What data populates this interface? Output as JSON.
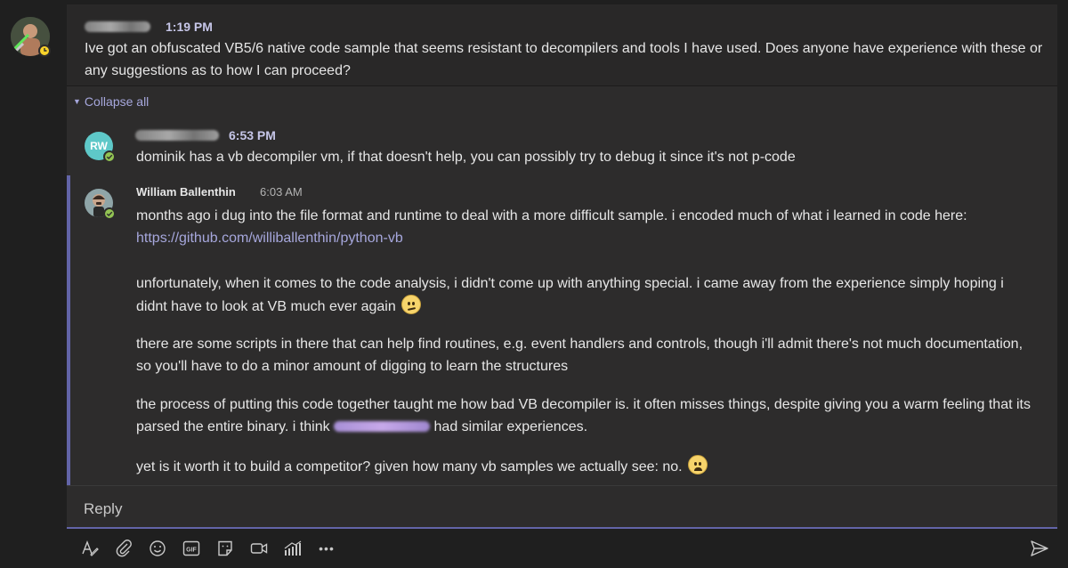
{
  "root": {
    "time": "1:19 PM",
    "text": "Ive got an obfuscated VB5/6 native code sample that seems resistant to decompilers and tools I have used. Does anyone have experience with these or any suggestions as to how I can proceed?",
    "presence": "away"
  },
  "collapse_label": "Collapse all",
  "replies": [
    {
      "initials": "RW",
      "avatar_color": "#5ec8c8",
      "time": "6:53 PM",
      "text": "dominik has a vb decompiler vm, if that doesn't help, you can possibly try to debug it since it's not p-code"
    },
    {
      "author": "William Ballenthin",
      "time": "6:03 AM",
      "p1": "months ago i dug into the file format and runtime to deal with a more difficult sample. i encoded much of what i learned in code here:",
      "link": "https://github.com/williballenthin/python-vb",
      "p2": "unfortunately, when it comes to the code analysis, i didn't come up with anything special. i came away from the experience simply hoping i didnt have to look at VB much ever again",
      "p3": "there are some scripts in there that can help find routines, e.g. event handlers and controls, though i'll admit there's not much documentation, so you'll have to do a minor amount of digging to learn the structures",
      "p4a": "the process of putting this code together taught me how bad VB decompiler is. it often misses things, despite giving you a warm feeling that its parsed the entire binary. i think",
      "p4b": "had similar experiences.",
      "p5": "yet is it worth it to build a competitor? given how many vb samples we actually see: no."
    }
  ],
  "reply_placeholder": "Reply",
  "toolbar_icons": [
    "format-icon",
    "attach-icon",
    "emoji-icon",
    "gif-icon",
    "sticker-icon",
    "meet-now-icon",
    "praise-icon",
    "more-options-icon"
  ],
  "gif_label": "GIF",
  "more_label": "•••",
  "colors": {
    "accent": "#6264a7",
    "link": "#a6a7dc",
    "available": "#92c353",
    "away": "#f8d22a"
  }
}
